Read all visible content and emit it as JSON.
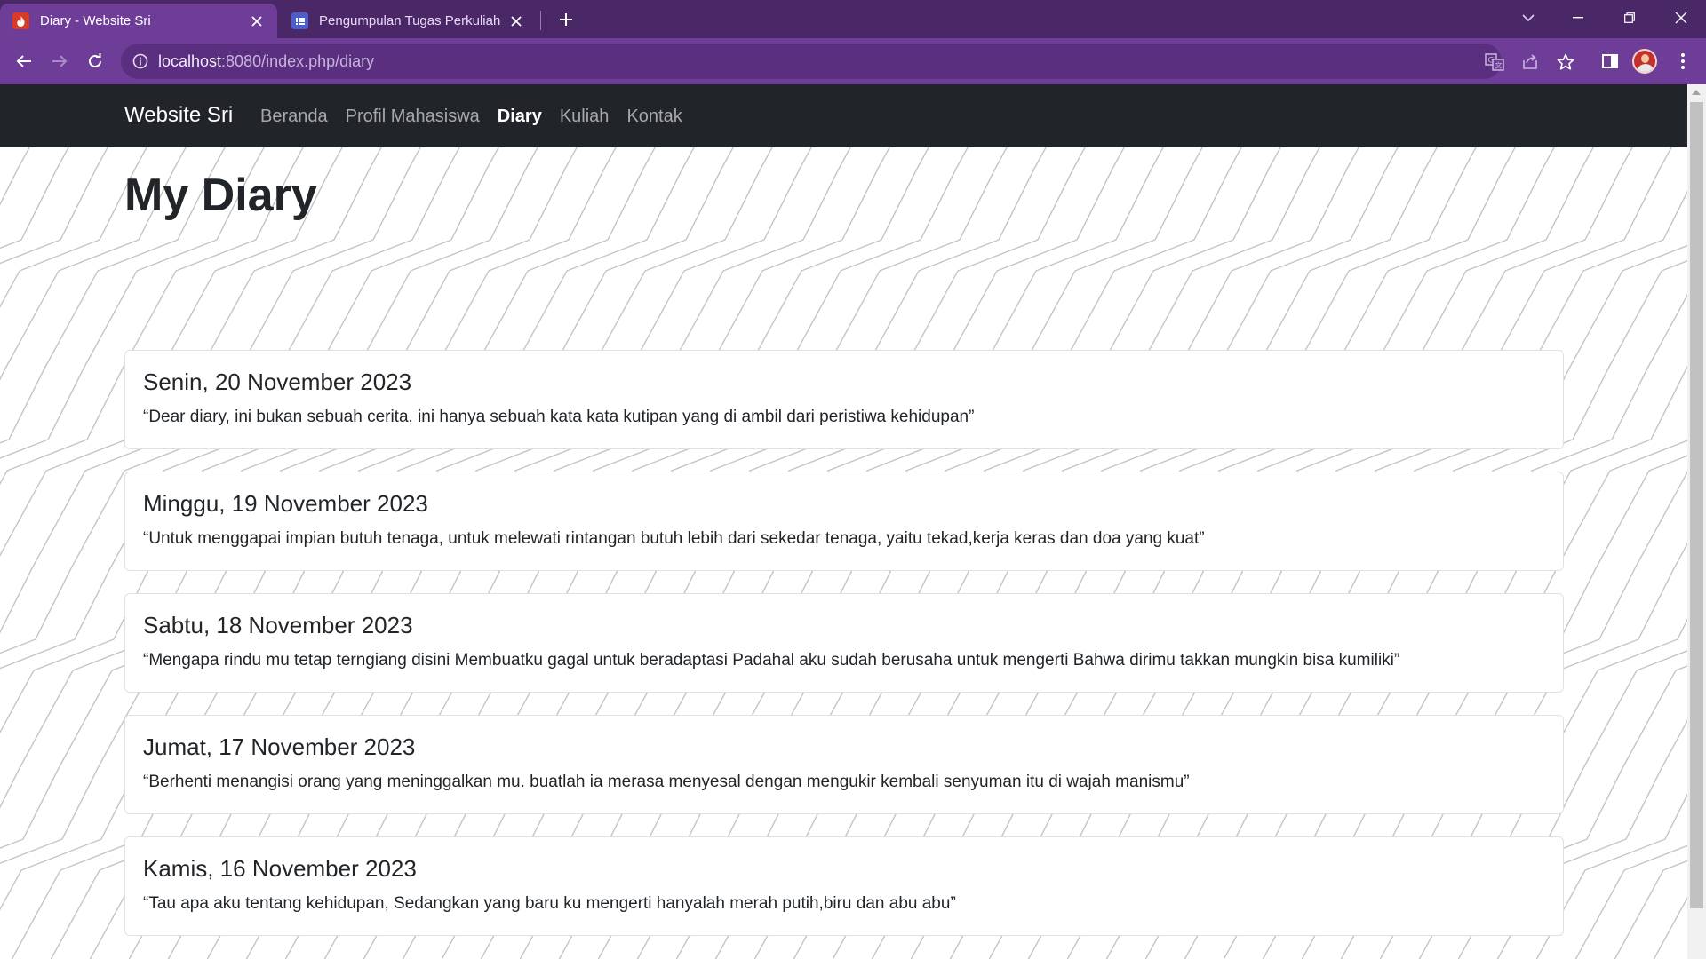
{
  "browser": {
    "tabs": [
      {
        "title": "Diary - Website Sri",
        "active": true,
        "favicon": "codeigniter-flame-icon"
      },
      {
        "title": "Pengumpulan Tugas Perkuliahan",
        "active": false,
        "favicon": "list-form-icon"
      }
    ],
    "url_host": "localhost",
    "url_path": ":8080/index.php/diary",
    "colors": {
      "frame": "#4a2867",
      "toolbar": "#6e3d98",
      "omnibox": "#5a2f80"
    }
  },
  "navbar": {
    "brand": "Website Sri",
    "links": [
      {
        "label": "Beranda",
        "active": false
      },
      {
        "label": "Profil Mahasiswa",
        "active": false
      },
      {
        "label": "Diary",
        "active": true
      },
      {
        "label": "Kuliah",
        "active": false
      },
      {
        "label": "Kontak",
        "active": false
      }
    ]
  },
  "page": {
    "title": "My Diary",
    "entries": [
      {
        "date": "Senin, 20 November 2023",
        "text": "“Dear diary, ini bukan sebuah cerita. ini hanya sebuah kata kata kutipan yang di ambil dari peristiwa kehidupan”"
      },
      {
        "date": "Minggu, 19 November 2023",
        "text": "“Untuk menggapai impian butuh tenaga, untuk melewati rintangan butuh lebih dari sekedar tenaga, yaitu tekad,kerja keras dan doa yang kuat”"
      },
      {
        "date": "Sabtu, 18 November 2023",
        "text": "“Mengapa rindu mu tetap terngiang disini Membuatku gagal untuk beradaptasi Padahal aku sudah berusaha untuk mengerti Bahwa dirimu takkan mungkin bisa kumiliki”"
      },
      {
        "date": "Jumat, 17 November 2023",
        "text": "“Berhenti menangisi orang yang meninggalkan mu. buatlah ia merasa menyesal dengan mengukir kembali senyuman itu di wajah manismu”"
      },
      {
        "date": "Kamis, 16 November 2023",
        "text": "“Tau apa aku tentang kehidupan, Sedangkan yang baru ku mengerti hanyalah merah putih,biru dan abu abu”"
      }
    ]
  }
}
